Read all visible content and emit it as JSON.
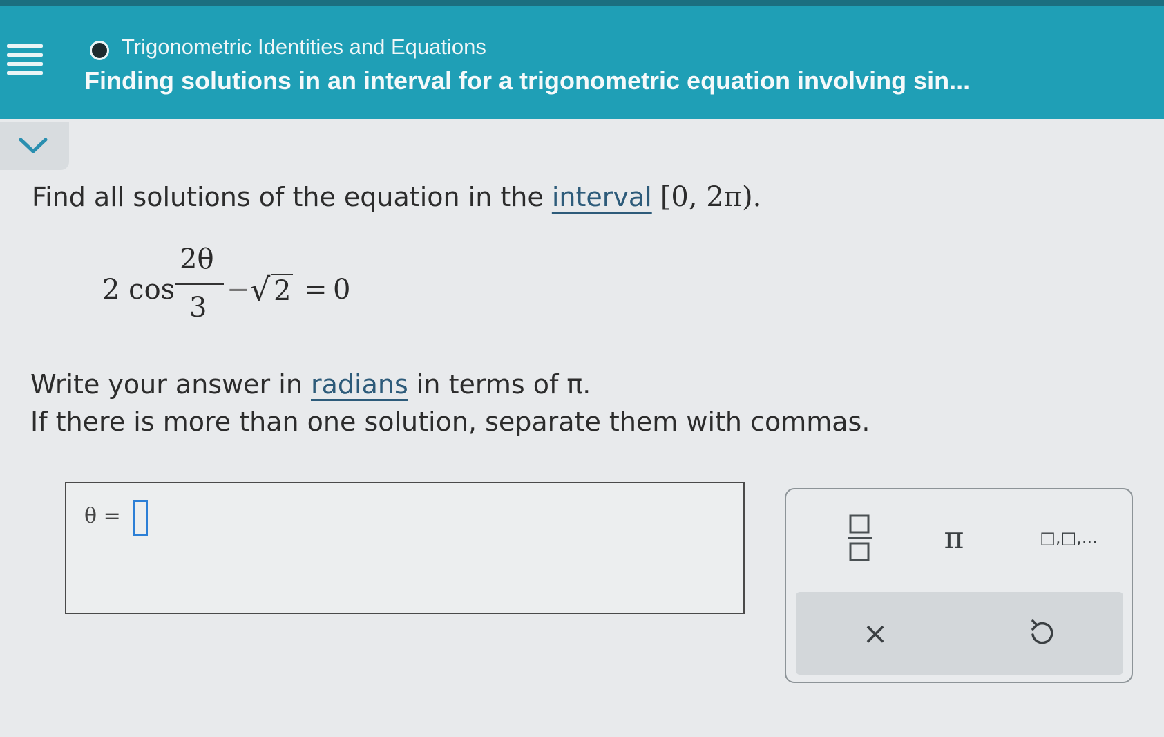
{
  "header": {
    "topic": "Trigonometric Identities and Equations",
    "subtitle": "Finding solutions in an interval for a trigonometric equation involving sin..."
  },
  "question": {
    "line1_prefix": "Find all solutions of the equation in the",
    "line1_link": "interval",
    "interval": "[0, 2π).",
    "equation": {
      "coefficient": "2 cos",
      "numerator": "2θ",
      "denominator": "3",
      "minus": "−",
      "radical": "√",
      "radicand": "2",
      "equals": "=",
      "rhs": "0"
    },
    "line2_prefix": "Write your answer in",
    "line2_link": "radians",
    "line2_suffix": "in terms of π.",
    "line3": "If there is more than one solution, separate them with commas."
  },
  "answer": {
    "label": "θ =",
    "value": ""
  },
  "keypad": {
    "pi_key": "π",
    "list_key": "□,□,...",
    "clear_key": "×"
  },
  "colors": {
    "header_bg": "#1f9fb6",
    "link": "#2d5b7a",
    "cursor": "#2c7fd6"
  }
}
